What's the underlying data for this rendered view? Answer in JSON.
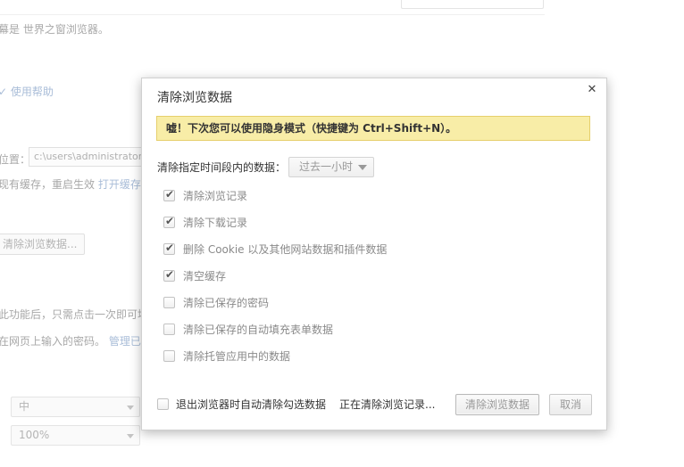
{
  "background": {
    "intro_text": "幕是 世界之窗浏览器。",
    "help_link": "✓ 使用帮助",
    "location_label": "位置：",
    "location_value": "c:\\users\\administrator\\",
    "cache_text": "现有缓存，重启生效",
    "open_cache_link": "打开缓存",
    "clear_data_button": "清除浏览数据...",
    "autofill_text": "此功能后，只需点击一次即可填",
    "password_text": "在网页上输入的密码。",
    "manage_link": "管理已保",
    "font_size_value": "中",
    "zoom_value": "100%"
  },
  "dialog": {
    "title": "清除浏览数据",
    "close_glyph": "✕",
    "notice": "嘘！下次您可以使用隐身模式（快捷键为 Ctrl+Shift+N）。",
    "range_label": "清除指定时间段内的数据：",
    "range_value": "过去一小时",
    "options": [
      {
        "label": "清除浏览记录",
        "checked": true
      },
      {
        "label": "清除下载记录",
        "checked": true
      },
      {
        "label": "删除 Cookie 以及其他网站数据和插件数据",
        "checked": true
      },
      {
        "label": "清空缓存",
        "checked": true
      },
      {
        "label": "清除已保存的密码",
        "checked": false
      },
      {
        "label": "清除已保存的自动填充表单数据",
        "checked": false
      },
      {
        "label": "清除托管应用中的数据",
        "checked": false
      }
    ],
    "auto_clear_label": "退出浏览器时自动清除勾选数据",
    "status": "正在清除浏览记录...",
    "clear_button": "清除浏览数据",
    "cancel_button": "取消",
    "check_glyph": "✔"
  }
}
